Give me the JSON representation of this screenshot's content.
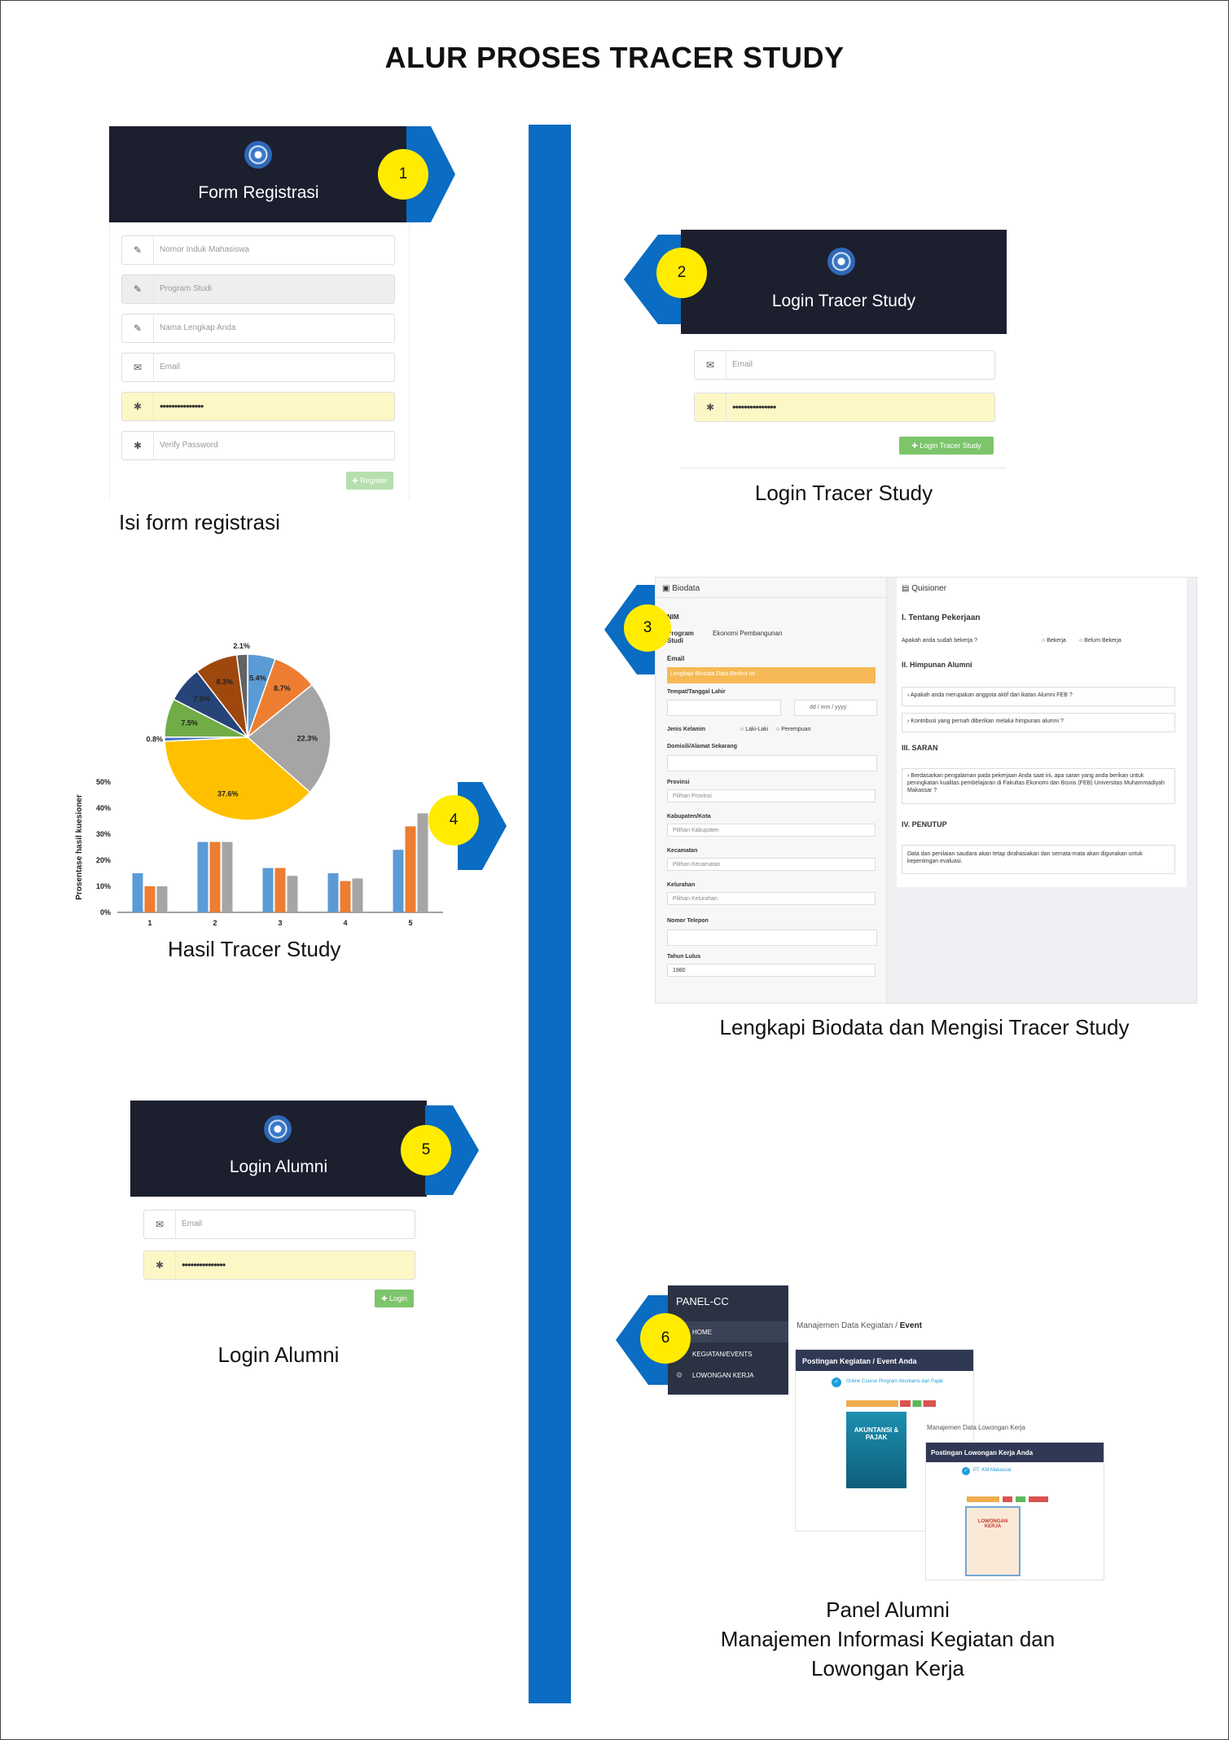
{
  "title": "ALUR PROSES TRACER STUDY",
  "steps": {
    "s1": {
      "num": "1",
      "header": "Form Registrasi",
      "caption": "Isi form registrasi",
      "fields": [
        "Nomor Induk Mahasiswa",
        "Program Studi",
        "Nama Lengkap Anda",
        "Email",
        "•••••••••••••••",
        "Verify Password"
      ],
      "button": "✚ Register"
    },
    "s2": {
      "num": "2",
      "header": "Login Tracer Study",
      "caption": "Login Tracer Study",
      "fields": [
        "Email",
        "•••••••••••••••"
      ],
      "button": "✚ Login Tracer Study"
    },
    "s3": {
      "num": "3",
      "caption": "Lengkapi Biodata dan Mengisi Tracer Study",
      "biodata": {
        "tab": "Biodata",
        "nim": "NIM",
        "prodi_label": "Program Studi",
        "prodi_value": "Ekonomi Pembangunan",
        "email": "Email",
        "banner": "Lengkapi Biodata Data Berikut Ini :",
        "ttl": "Tempat/Tanggal Lahir",
        "date_ph": "dd / mm / yyyy",
        "jk": "Jenis Kelamin",
        "laki": "Laki-Laki",
        "perempuan": "Perempuan",
        "domisili": "Domisili/Alamat Sekarang",
        "provinsi": "Provinsi",
        "prov_ph": "Pilihan Provinsi",
        "kab": "Kabupaten/Kota",
        "kab_ph": "Pilihan Kabupaten",
        "kec": "Kecamatan",
        "kec_ph": "Pilihan Kecamatan",
        "kel": "Kelurahan",
        "kel_ph": "Pilihan Kelurahan",
        "telp": "Nomor Telepon",
        "tahun": "Tahun Lulus",
        "tahun_val": "1980"
      },
      "quisioner": {
        "tab": "Quisioner",
        "s1": "I. Tentang Pekerjaan",
        "q1": "Apakah anda sudah bekerja ?",
        "opt1": "Bekerja",
        "opt2": "Belum Bekerja",
        "s2": "II. Himpunan Alumni",
        "q2": "› Apakah anda merupakan anggota aktif dari ikatan Alumni FEB ?",
        "q3": "› Kontribusi yang pernah diberikan melalui himpunan alumni ?",
        "s3": "III. SARAN",
        "q4": "› Berdasarkan pengalaman pada pekerjaan Anda saat ini, apa saran yang anda berikan untuk peningkatan kualitas pembelajaran di Fakultas Ekonomi dan Bisnis (FEB) Universitas Muhammadiyah Makassar ?",
        "s4": "IV. PENUTUP",
        "q5": "Data dan penilaian saudara akan tetap dirahasiakan dan semata-mata akan digunakan untuk kepentingan evaluasi."
      }
    },
    "s4": {
      "num": "4",
      "caption": "Hasil Tracer Study",
      "ylabel": "Prosentase hasil kuesioner"
    },
    "s5": {
      "num": "5",
      "header": "Login Alumni",
      "caption": "Login Alumni",
      "fields": [
        "Email",
        "•••••••••••••••"
      ],
      "button": "✚ Login"
    },
    "s6": {
      "num": "6",
      "caption": [
        "Panel Alumni",
        "Manajemen Informasi Kegiatan dan",
        "Lowongan Kerja"
      ],
      "brand": "PANEL-CC",
      "menu": [
        "HOME",
        "KEGIATAN/EVENTS",
        "LOWONGAN KERJA"
      ],
      "breadcrumb": "Manajemen Data Kegiatan / ",
      "breadcrumb_b": "Event",
      "card1": "Postingan Kegiatan / Event Anda",
      "event_title": "Online Course Program Akuntansi dan Pajak",
      "poster1": "AKUNTANSI & PAJAK",
      "breadcrumb2": "Manajemen Data Lowongan Kerja",
      "card2": "Postingan Lowongan Kerja Anda",
      "job_company": "PT. KM Makassar",
      "poster2": "LOWONGAN KERJA"
    }
  },
  "chart_data": [
    {
      "type": "pie",
      "labels": [
        "5.4%",
        "8.7%",
        "22.3%",
        "37.6%",
        "0.8%",
        "7.5%",
        "7.0%",
        "8.3%",
        "2.1%"
      ],
      "values": [
        5.4,
        8.7,
        22.3,
        37.6,
        0.8,
        7.5,
        7.0,
        8.3,
        2.1
      ],
      "colors": [
        "#5b9bd5",
        "#ed7d31",
        "#a5a5a5",
        "#ffc000",
        "#4472c4",
        "#70ad47",
        "#264478",
        "#9e480e",
        "#636363"
      ]
    },
    {
      "type": "bar",
      "categories": [
        "1",
        "2",
        "3",
        "4",
        "5"
      ],
      "series": [
        {
          "values": [
            15,
            27,
            17,
            15,
            24
          ],
          "color": "#5b9bd5"
        },
        {
          "values": [
            10,
            27,
            17,
            12,
            33
          ],
          "color": "#ed7d31"
        },
        {
          "values": [
            10,
            27,
            14,
            13,
            38
          ],
          "color": "#a5a5a5"
        }
      ],
      "ylabel": "Prosentase hasil kuesioner",
      "yticks": [
        "0%",
        "10%",
        "20%",
        "30%",
        "40%",
        "50%"
      ],
      "ylim": [
        0,
        50
      ]
    }
  ]
}
